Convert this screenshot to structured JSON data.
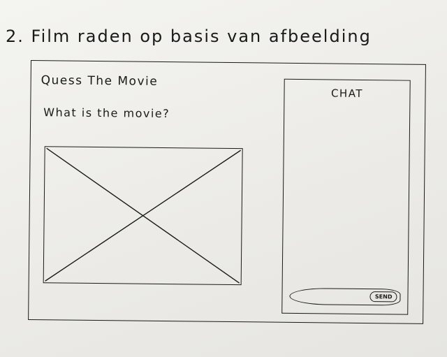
{
  "sketch": {
    "heading": "2. Film raden op basis van afbeelding"
  },
  "app": {
    "title": "Quess The Movie",
    "question": "What is the movie?"
  },
  "image": {
    "icon": "image-placeholder-icon"
  },
  "chat": {
    "title": "CHAT",
    "send_label": "SEND"
  }
}
